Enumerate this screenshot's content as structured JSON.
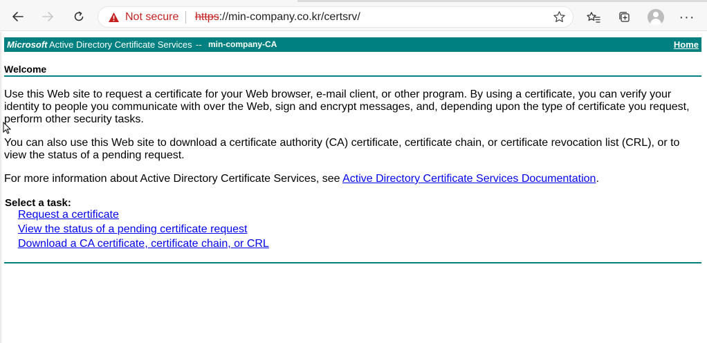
{
  "browser": {
    "security_label": "Not secure",
    "url_scheme": "https",
    "url_rest": "://min-company.co.kr/certsrv/",
    "icons": [
      "back-icon",
      "forward-icon",
      "refresh-icon",
      "warning-icon",
      "star-icon",
      "favorites-icon",
      "collections-icon",
      "profile-avatar",
      "more-icon"
    ]
  },
  "banner": {
    "brand": "Microsoft",
    "product": "Active Directory Certificate Services",
    "separator": "--",
    "ca_name": "min-company-CA",
    "home_link": "Home"
  },
  "page": {
    "heading": "Welcome",
    "para1": "Use this Web site to request a certificate for your Web browser, e-mail client, or other program. By using a certificate, you can verify your identity to people you communicate with over the Web, sign and encrypt messages, and, depending upon the type of certificate you request, perform other security tasks.",
    "para2": "You can also use this Web site to download a certificate authority (CA) certificate, certificate chain, or certificate revocation list (CRL), or to view the status of a pending request.",
    "para3_prefix": "For more information about Active Directory Certificate Services, see ",
    "para3_link": "Active Directory Certificate Services Documentation",
    "para3_suffix": ".",
    "task_heading": "Select a task:",
    "tasks": [
      "Request a certificate",
      "View the status of a pending certificate request",
      "Download a CA certificate, certificate chain, or CRL"
    ]
  },
  "colors": {
    "banner_bg": "#008080",
    "link": "#0000ee",
    "not_secure": "#c5221f"
  }
}
